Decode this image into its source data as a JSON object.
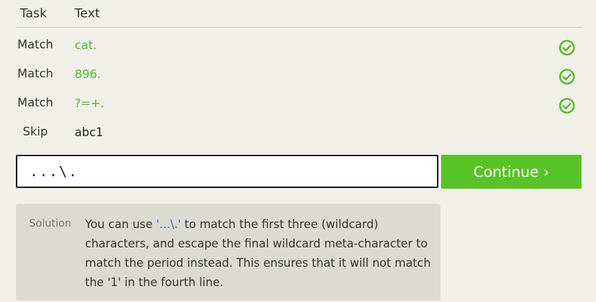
{
  "header": {
    "task_label": "Task",
    "text_label": "Text"
  },
  "rows": [
    {
      "task": "Match",
      "text": "cat.",
      "status": "check-icon"
    },
    {
      "task": "Match",
      "text": "896.",
      "status": "check-icon"
    },
    {
      "task": "Match",
      "text": "?=+.",
      "status": "check-icon"
    },
    {
      "task": "Skip",
      "text": "abc1"
    }
  ],
  "input": {
    "value": "...\\."
  },
  "continue_label": "Continue ›",
  "solution": {
    "label": "Solution",
    "text_before": "You can use ",
    "code": "'...\\.'",
    "text_after": " to match the first three (wildcard) characters, and escape the final wildcard meta-character to match the period instead. This ensures that it will not match the '1' in the fourth line."
  },
  "colors": {
    "match_green": "#5ab82f",
    "button_green": "#58c327",
    "background": "#f0efe8",
    "solution_bg": "#dcdbd1",
    "code_blue": "#2c6fd1"
  }
}
